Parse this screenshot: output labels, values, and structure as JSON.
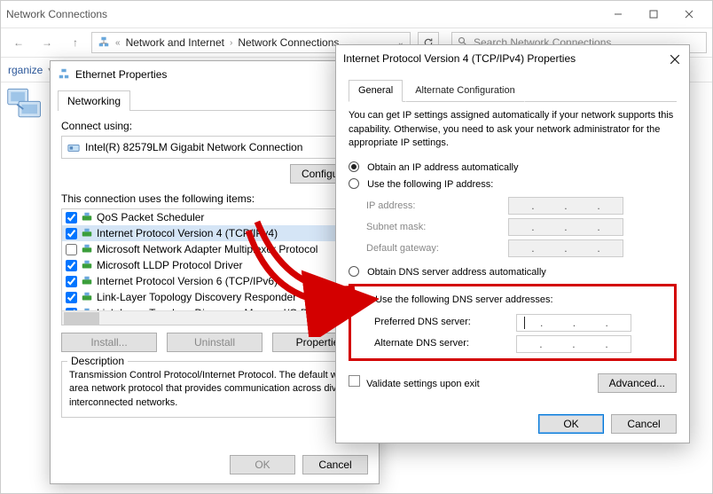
{
  "explorer": {
    "title": "Network Connections",
    "breadcrumb1": "Network and Internet",
    "breadcrumb2": "Network Connections",
    "search_placeholder": "Search Network Connections",
    "organize": "rganize"
  },
  "dlg1": {
    "title": "Ethernet Properties",
    "tab": "Networking",
    "connect_using_label": "Connect using:",
    "adapter": "Intel(R) 82579LM Gigabit Network Connection",
    "configure": "Configure...",
    "items_label": "This connection uses the following items:",
    "items": [
      {
        "checked": true,
        "label": "QoS Packet Scheduler"
      },
      {
        "checked": true,
        "label": "Internet Protocol Version 4 (TCP/IPv4)"
      },
      {
        "checked": false,
        "label": "Microsoft Network Adapter Multiplexor Protocol"
      },
      {
        "checked": true,
        "label": "Microsoft LLDP Protocol Driver"
      },
      {
        "checked": true,
        "label": "Internet Protocol Version 6 (TCP/IPv6)"
      },
      {
        "checked": true,
        "label": "Link-Layer Topology Discovery Responder"
      },
      {
        "checked": true,
        "label": "Link-Layer Topology Discovery Mapper I/O Driver"
      }
    ],
    "install": "Install...",
    "uninstall": "Uninstall",
    "properties": "Properties",
    "desc_title": "Description",
    "desc": "Transmission Control Protocol/Internet Protocol. The default wide area network protocol that provides communication across diverse interconnected networks.",
    "ok": "OK",
    "cancel": "Cancel"
  },
  "dlg2": {
    "title": "Internet Protocol Version 4 (TCP/IPv4) Properties",
    "tab_general": "General",
    "tab_alt": "Alternate Configuration",
    "intro": "You can get IP settings assigned automatically if your network supports this capability. Otherwise, you need to ask your network administrator for the appropriate IP settings.",
    "ip_auto": "Obtain an IP address automatically",
    "ip_manual": "Use the following IP address:",
    "ip_address": "IP address:",
    "subnet": "Subnet mask:",
    "gateway": "Default gateway:",
    "dns_auto": "Obtain DNS server address automatically",
    "dns_manual": "Use the following DNS server addresses:",
    "dns_pref": "Preferred DNS server:",
    "dns_alt": "Alternate DNS server:",
    "validate": "Validate settings upon exit",
    "advanced": "Advanced...",
    "ok": "OK",
    "cancel": "Cancel"
  }
}
